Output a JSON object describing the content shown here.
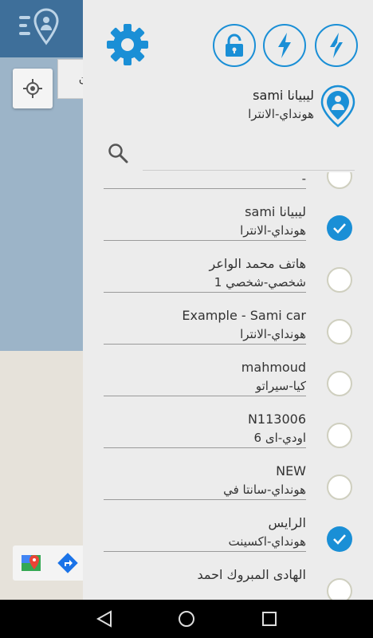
{
  "colors": {
    "accent": "#1a8fd6",
    "drawer_bg": "#ececec",
    "topbar": "#3e6f9a"
  },
  "drawer": {
    "current_vehicle": {
      "name": "sami ليبيانا",
      "model": "هونداي-الانترا"
    },
    "search": {
      "placeholder": "",
      "value": ""
    },
    "vehicles": [
      {
        "name": "",
        "model": "-",
        "checked": false
      },
      {
        "name": "sami ليبيانا",
        "model": "هونداي-الانترا",
        "checked": true
      },
      {
        "name": "هاتف محمد الواعر",
        "model": "شخصي-شخصي 1",
        "checked": false
      },
      {
        "name": "Example - Sami car",
        "model": "هونداي-الانترا",
        "checked": false
      },
      {
        "name": "mahmoud",
        "model": "كيا-سيراتو",
        "checked": false
      },
      {
        "name": "N113006",
        "model": "اودي-اى 6",
        "checked": false
      },
      {
        "name": "NEW",
        "model": "هونداي-سانتا في",
        "checked": false
      },
      {
        "name": "الرايس",
        "model": "هونداي-اكسينت",
        "checked": true
      },
      {
        "name": "الهادى المبروك احمد",
        "model": "",
        "checked": false
      }
    ],
    "icons": {
      "settings": "gear-icon",
      "lock": "lock-icon",
      "bolt1": "bolt-icon",
      "bolt2": "bolt-outline-icon",
      "pin": "location-pin-icon",
      "search": "search-icon"
    }
  },
  "background": {
    "chip_text": "ن"
  }
}
